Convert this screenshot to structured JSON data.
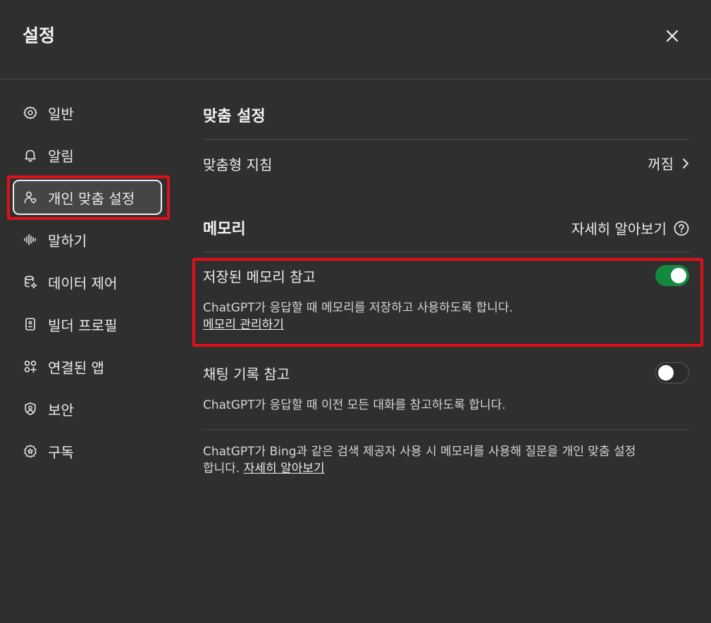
{
  "header": {
    "title": "설정",
    "close_icon": "close-icon"
  },
  "sidebar": {
    "items": [
      {
        "label": "일반",
        "icon": "gear-icon"
      },
      {
        "label": "알림",
        "icon": "bell-icon"
      },
      {
        "label": "개인 맞춤 설정",
        "icon": "person-heart-icon",
        "active": true
      },
      {
        "label": "말하기",
        "icon": "waveform-icon"
      },
      {
        "label": "데이터 제어",
        "icon": "database-gear-icon"
      },
      {
        "label": "빌더 프로필",
        "icon": "id-badge-icon"
      },
      {
        "label": "연결된 앱",
        "icon": "apps-grid-icon"
      },
      {
        "label": "보안",
        "icon": "shield-person-icon"
      },
      {
        "label": "구독",
        "icon": "badge-star-icon"
      }
    ]
  },
  "main": {
    "personalization": {
      "title": "맞춤 설정",
      "custom_instructions_label": "맞춤형 지침",
      "custom_instructions_value": "꺼짐"
    },
    "memory": {
      "title": "메모리",
      "learn_more": "자세히 알아보기",
      "saved_memory": {
        "label": "저장된 메모리 참고",
        "toggle": "on",
        "description": "ChatGPT가 응답할 때 메모리를 저장하고 사용하도록 합니다.",
        "manage_link": "메모리 관리하기"
      },
      "chat_history": {
        "label": "채팅 기록 참고",
        "toggle": "off",
        "description": "ChatGPT가 응답할 때 이전 모든 대화를 참고하도록 합니다."
      },
      "footer_text": "ChatGPT가 Bing과 같은 검색 제공자 사용 시 메모리를 사용해 질문을 개인 맞춤 설정합니다.",
      "footer_link": "자세히 알아보기"
    }
  },
  "colors": {
    "background": "#2f2f2f",
    "toggle_on": "#13883f",
    "highlight": "#e0101a"
  }
}
